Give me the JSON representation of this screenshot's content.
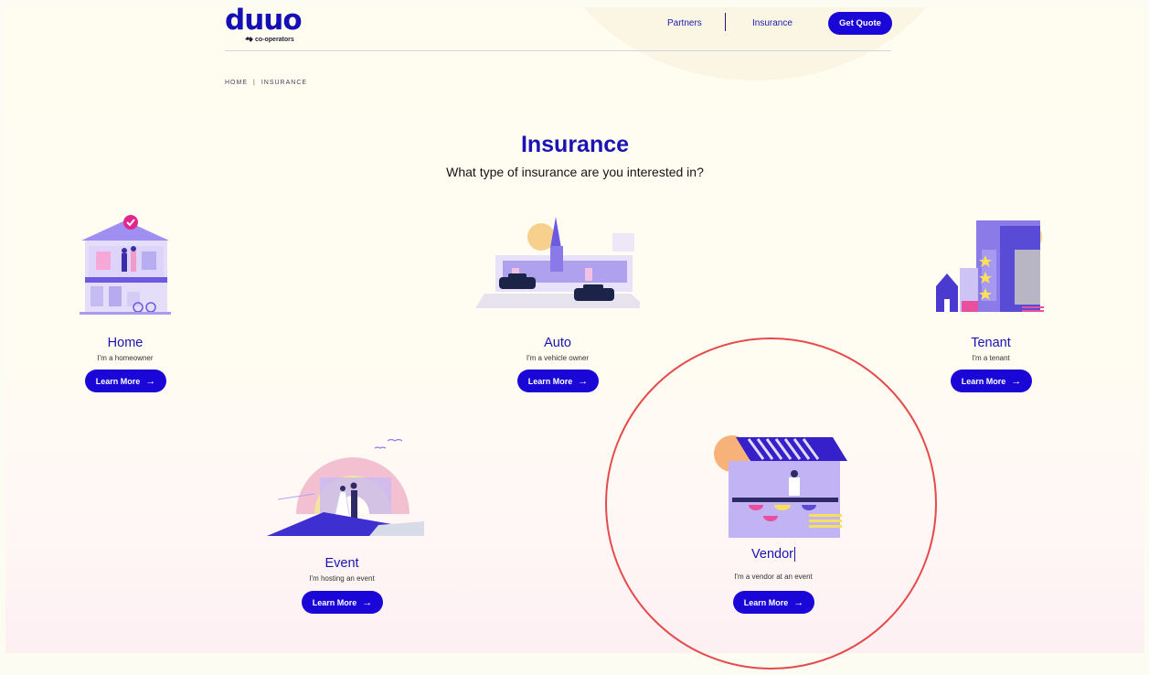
{
  "header": {
    "logo_text": "duuo",
    "logo_sub": "co-operators",
    "nav": {
      "partners": "Partners",
      "insurance": "Insurance"
    },
    "get_quote_label": "Get Quote"
  },
  "breadcrumb": {
    "home": "HOME",
    "separator": "|",
    "current": "INSURANCE"
  },
  "page": {
    "title": "Insurance",
    "subtitle": "What type of insurance are you interested in?"
  },
  "cards": {
    "home": {
      "title": "Home",
      "desc": "I'm a homeowner",
      "button": "Learn More"
    },
    "auto": {
      "title": "Auto",
      "desc": "I'm a vehicle owner",
      "button": "Learn More"
    },
    "tenant": {
      "title": "Tenant",
      "desc": "I'm a tenant",
      "button": "Learn More"
    },
    "event": {
      "title": "Event",
      "desc": "I'm hosting an event",
      "button": "Learn More"
    },
    "vendor": {
      "title": "Vendor",
      "desc": "I'm a vendor at an event",
      "button": "Learn More"
    }
  },
  "icons": {
    "arrow": "arrow-right-icon",
    "logo_mark": "co-operators-mark-icon"
  },
  "colors": {
    "brand_blue": "#1a06d6",
    "title_blue": "#1a13b5",
    "highlight_red": "#e64b4b"
  }
}
